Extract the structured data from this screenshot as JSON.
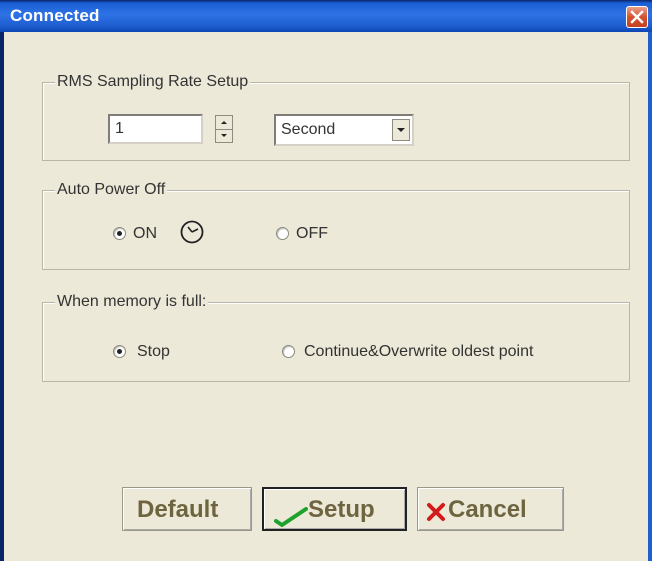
{
  "window": {
    "title": "Connected"
  },
  "rms": {
    "legend": "RMS Sampling Rate Setup",
    "value": "1",
    "unit": "Second"
  },
  "auto_power": {
    "legend": "Auto Power Off",
    "on_label": "ON",
    "off_label": "OFF",
    "selected": "ON"
  },
  "memory": {
    "legend": "When memory is full:",
    "stop_label": "Stop",
    "continue_label": "Continue&Overwrite oldest point",
    "selected": "Stop"
  },
  "buttons": {
    "default_label": "Default",
    "setup_label": "Setup",
    "cancel_label": "Cancel"
  },
  "colors": {
    "titlebar": "#2E72E5",
    "dialog": "#ECE9D8",
    "button_text": "#6E6540",
    "checkmark": "#1FA12E",
    "cancel_x": "#D21C1C"
  }
}
